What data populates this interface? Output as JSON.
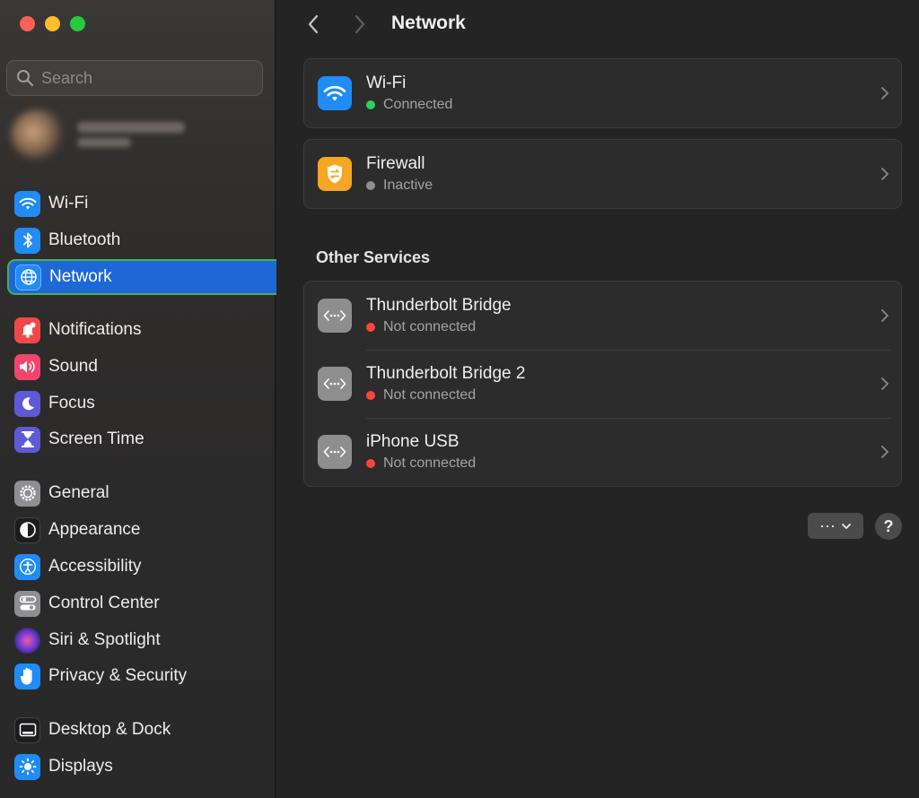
{
  "window": {
    "traffic_lights": [
      "close",
      "minimize",
      "zoom"
    ]
  },
  "search": {
    "placeholder": "Search"
  },
  "sidebar": {
    "items": [
      {
        "label": "Wi-Fi",
        "icon": "wifi-icon",
        "color": "#1f8cf7"
      },
      {
        "label": "Bluetooth",
        "icon": "bluetooth-icon",
        "color": "#1f8cf7"
      },
      {
        "label": "Network",
        "icon": "globe-icon",
        "color": "#1f8cf7",
        "selected": true
      },
      {
        "label": "Notifications",
        "icon": "bell-icon",
        "color": "#f2474a"
      },
      {
        "label": "Sound",
        "icon": "speaker-icon",
        "color": "#f2456e"
      },
      {
        "label": "Focus",
        "icon": "moon-icon",
        "color": "#5e5ad6"
      },
      {
        "label": "Screen Time",
        "icon": "hourglass-icon",
        "color": "#5e5ad6"
      },
      {
        "label": "General",
        "icon": "gear-icon",
        "color": "#8e8e93"
      },
      {
        "label": "Appearance",
        "icon": "appearance-icon",
        "color": "#1c1c1e"
      },
      {
        "label": "Accessibility",
        "icon": "accessibility-icon",
        "color": "#1f8cf7"
      },
      {
        "label": "Control Center",
        "icon": "toggles-icon",
        "color": "#8e8e93"
      },
      {
        "label": "Siri & Spotlight",
        "icon": "siri-icon",
        "color": "#7a3ad6"
      },
      {
        "label": "Privacy & Security",
        "icon": "hand-icon",
        "color": "#1f8cf7"
      },
      {
        "label": "Desktop & Dock",
        "icon": "dock-icon",
        "color": "#1c1c1e"
      },
      {
        "label": "Displays",
        "icon": "sun-icon",
        "color": "#1f8cf7"
      }
    ]
  },
  "header": {
    "title": "Network"
  },
  "main": {
    "wifi": {
      "name": "Wi-Fi",
      "status": "Connected",
      "status_color": "#30d158"
    },
    "firewall": {
      "name": "Firewall",
      "status": "Inactive",
      "status_color": "#8e8e93"
    },
    "other_services": {
      "title": "Other Services",
      "items": [
        {
          "name": "Thunderbolt Bridge",
          "status": "Not connected",
          "status_color": "#ff453a"
        },
        {
          "name": "Thunderbolt Bridge 2",
          "status": "Not connected",
          "status_color": "#ff453a"
        },
        {
          "name": "iPhone USB",
          "status": "Not connected",
          "status_color": "#ff453a"
        }
      ]
    },
    "more_button": {
      "label": "···"
    },
    "help_button": {
      "label": "?"
    }
  }
}
